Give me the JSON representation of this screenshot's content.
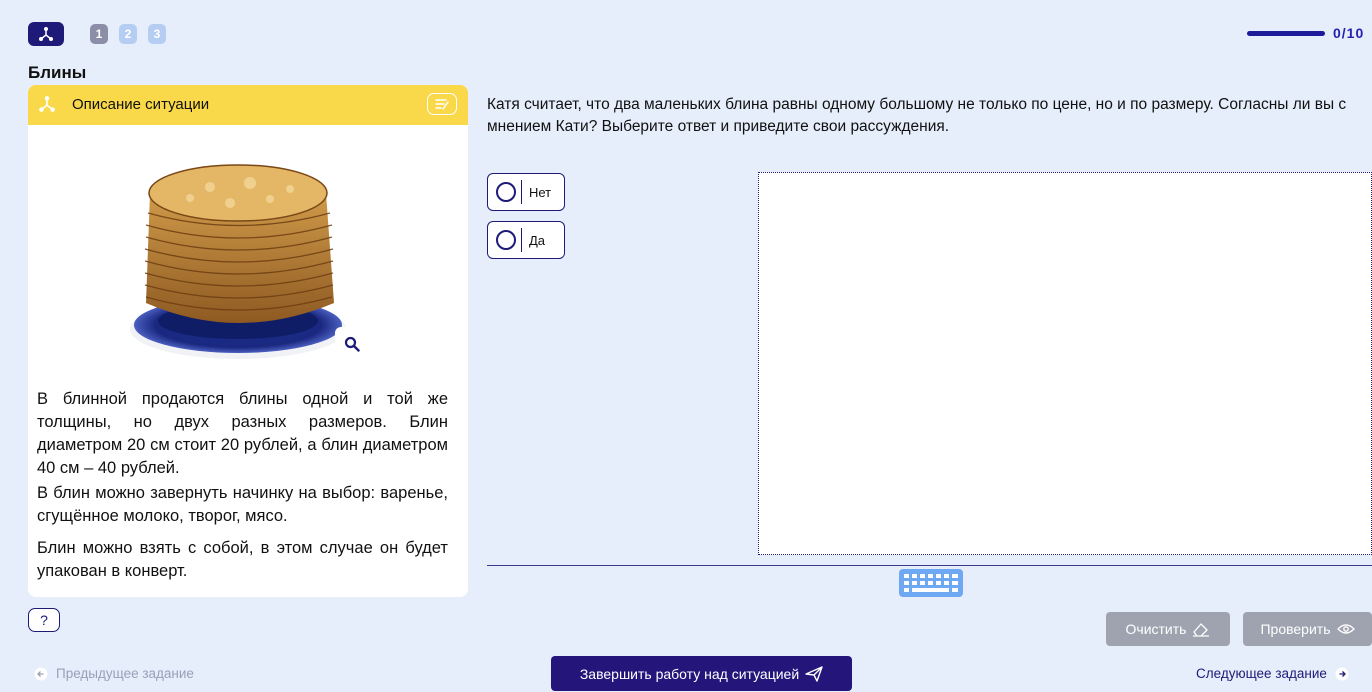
{
  "nav": {
    "steps": [
      "1",
      "2",
      "3"
    ],
    "progress_text": "0/10",
    "progress_value": 0
  },
  "page_title": "Блины",
  "situation": {
    "header_label": "Описание ситуации",
    "paragraphs": [
      "В блинной продаются блины одной и той же толщины, но двух разных размеров. Блин диаметром 20 см стоит 20 рублей, а блин диаметром 40 см – 40 рублей.",
      "В блин можно завернуть начинку на выбор: варенье, сгущённое молоко, творог, мясо.",
      "Блин можно взять с собой, в этом случае он будет упакован в конверт."
    ]
  },
  "help_label": "?",
  "question": {
    "text": "Катя считает, что два маленьких блина равны одному большому не только по цене, но и по размеру. Согласны ли вы с мнением Кати? Выберите ответ и приведите свои рассуждения.",
    "options": [
      "Нет",
      "Да"
    ]
  },
  "actions": {
    "clear_label": "Очистить",
    "check_label": "Проверить"
  },
  "footer": {
    "prev_label": "Предыдущее задание",
    "finish_label": "Завершить работу над ситуацией",
    "next_label": "Следующее задание"
  },
  "colors": {
    "background": "#e6eefb",
    "brand": "#1e1b78",
    "header_yellow": "#f9d949",
    "disabled_button": "#9fa3b0"
  }
}
